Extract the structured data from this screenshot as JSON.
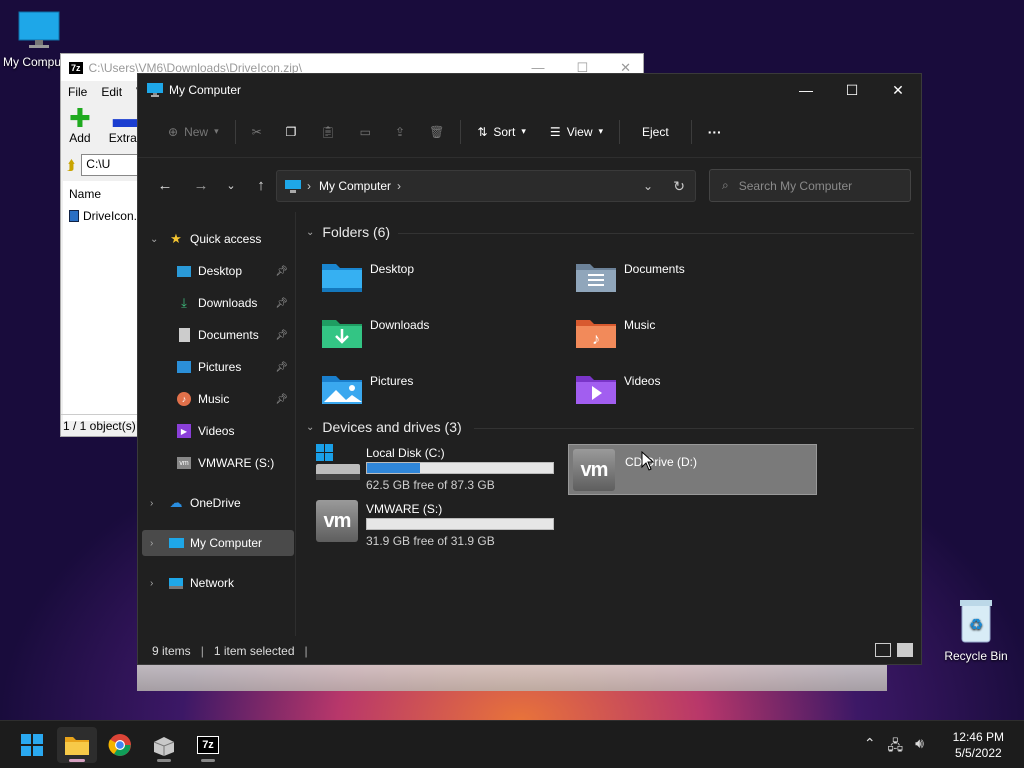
{
  "desktop": {
    "my_computer_label": "My Computer",
    "recycle_bin_label": "Recycle Bin"
  },
  "sevenzip": {
    "logo": "7z",
    "title": "C:\\Users\\VM6\\Downloads\\DriveIcon.zip\\",
    "menu": [
      "File",
      "Edit",
      "V"
    ],
    "add_label": "Add",
    "extract_label": "Extrac",
    "address": "C:\\U",
    "column_name": "Name",
    "file_name": "DriveIcon.",
    "status": "1 / 1 object(s)"
  },
  "explorer": {
    "title": "My Computer",
    "commands": {
      "new": "New",
      "sort": "Sort",
      "view": "View",
      "eject": "Eject",
      "more": "···"
    },
    "breadcrumb": "My Computer",
    "search_placeholder": "Search My Computer",
    "nav": {
      "quick_access": "Quick access",
      "items": [
        "Desktop",
        "Downloads",
        "Documents",
        "Pictures",
        "Music",
        "Videos",
        "VMWARE (S:)"
      ],
      "onedrive": "OneDrive",
      "my_computer": "My Computer",
      "network": "Network"
    },
    "folders_header": "Folders (6)",
    "folders": [
      "Desktop",
      "Documents",
      "Downloads",
      "Music",
      "Pictures",
      "Videos"
    ],
    "drives_header": "Devices and drives (3)",
    "drives": [
      {
        "name": "Local Disk (C:)",
        "free": "62.5 GB free of 87.3 GB",
        "used_fraction": 0.284
      },
      {
        "name": "CD Drive (D:)"
      },
      {
        "name": "VMWARE (S:)",
        "free": "31.9 GB free of 31.9 GB",
        "used_fraction": 0.0
      }
    ],
    "status": {
      "items": "9 items",
      "selected": "1 item selected"
    }
  },
  "taskbar": {
    "time": "12:46 PM",
    "date": "5/5/2022",
    "sevenzip_label": "7z"
  },
  "colors": {
    "accent": "#2f86d9",
    "explorer_bg": "#202020"
  }
}
